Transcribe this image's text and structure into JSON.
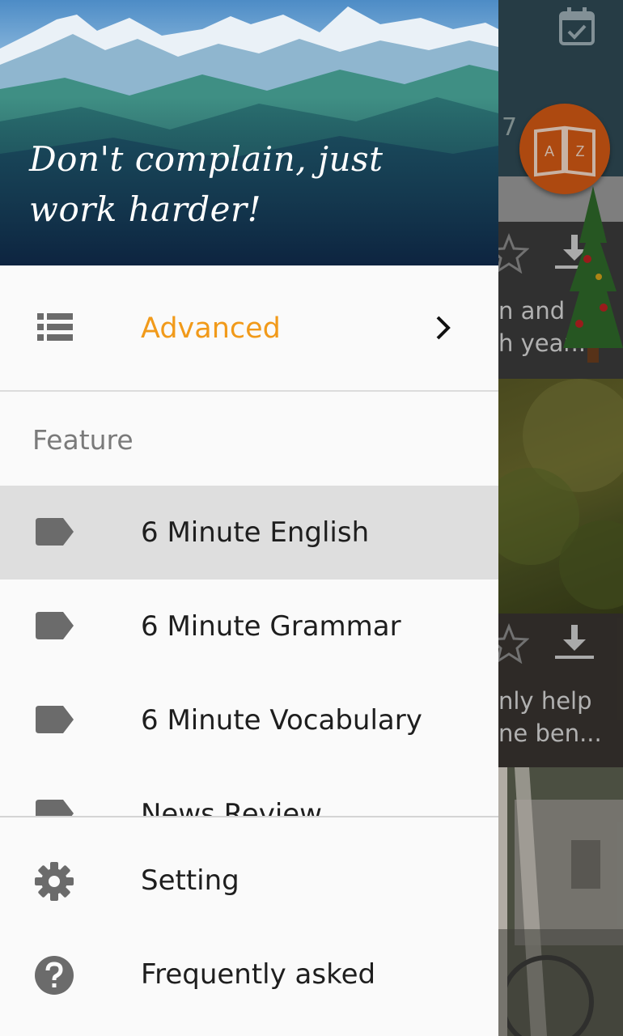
{
  "drawer": {
    "quote": "Don't complain, just work harder!",
    "advanced": {
      "label": "Advanced",
      "icon": "list-icon",
      "color": "#f19a1a"
    },
    "section_title": "Feature",
    "nav_items": [
      {
        "label": "6 Minute English",
        "icon": "tag-icon",
        "selected": true
      },
      {
        "label": "6 Minute Grammar",
        "icon": "tag-icon"
      },
      {
        "label": "6 Minute Vocabulary",
        "icon": "tag-icon"
      },
      {
        "label": "News Review",
        "icon": "tag-icon"
      }
    ],
    "bottom_items": [
      {
        "label": "Setting",
        "icon": "gear-icon"
      },
      {
        "label": "Frequently asked",
        "icon": "help-icon"
      }
    ]
  },
  "background_app": {
    "header_count": "7",
    "fab_letters": "A Z",
    "card1_lines": [
      "n and",
      "h year..."
    ],
    "card3_lines": [
      "nly help",
      "ne ben..."
    ]
  }
}
